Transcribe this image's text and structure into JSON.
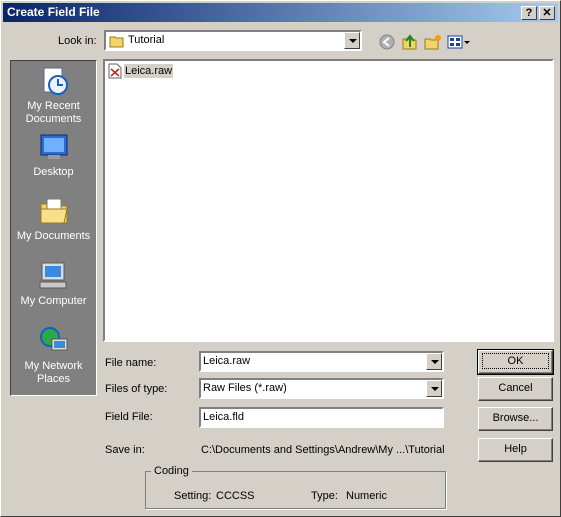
{
  "window": {
    "title": "Create Field File",
    "help_glyph": "?",
    "close_glyph": "✕"
  },
  "toolbar": {
    "look_in_label": "Look in:",
    "look_in_value": "Tutorial"
  },
  "places": {
    "items": [
      {
        "label_1": "My Recent",
        "label_2": "Documents"
      },
      {
        "label_1": "Desktop",
        "label_2": ""
      },
      {
        "label_1": "My Documents",
        "label_2": ""
      },
      {
        "label_1": "My Computer",
        "label_2": ""
      },
      {
        "label_1": "My Network",
        "label_2": "Places"
      }
    ]
  },
  "files": [
    {
      "name": "Leica.raw"
    }
  ],
  "form": {
    "file_name_label": "File name:",
    "file_name_value": "Leica.raw",
    "files_of_type_label": "Files of type:",
    "files_of_type_value": "Raw Files (*.raw)",
    "field_file_label": "Field File:",
    "field_file_value": "Leica.fld",
    "save_in_label": "Save in:",
    "save_in_value": "C:\\Documents and Settings\\Andrew\\My ...\\Tutorial"
  },
  "buttons": {
    "ok": "OK",
    "cancel": "Cancel",
    "browse": "Browse...",
    "help": "Help"
  },
  "coding": {
    "legend": "Coding",
    "setting_label": "Setting:",
    "setting_value": "CCCSS",
    "type_label": "Type:",
    "type_value": "Numeric"
  }
}
